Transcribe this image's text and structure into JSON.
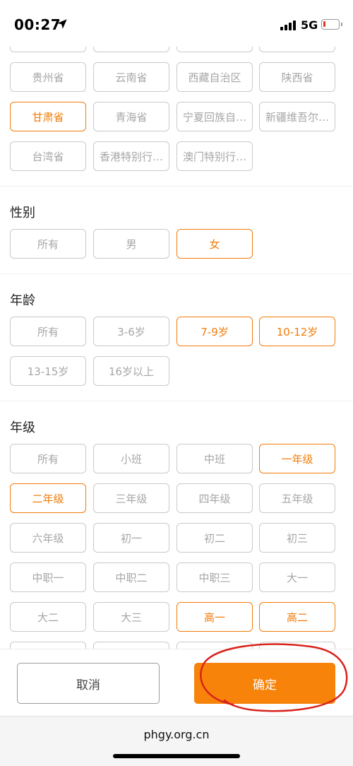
{
  "status": {
    "time": "00:27",
    "network": "5G",
    "battery_level": 0.1,
    "battery_color": "#e0382f"
  },
  "colors": {
    "accent": "#f27c0a",
    "confirm_bg": "#f8830b",
    "annotation": "#d8231b"
  },
  "province": {
    "options": [
      {
        "label": "贵州省",
        "selected": false
      },
      {
        "label": "云南省",
        "selected": false
      },
      {
        "label": "西藏自治区",
        "selected": false
      },
      {
        "label": "陕西省",
        "selected": false
      },
      {
        "label": "甘肃省",
        "selected": true
      },
      {
        "label": "青海省",
        "selected": false
      },
      {
        "label": "宁夏回族自…",
        "selected": false
      },
      {
        "label": "新疆维吾尔…",
        "selected": false
      },
      {
        "label": "台湾省",
        "selected": false
      },
      {
        "label": "香港特别行…",
        "selected": false
      },
      {
        "label": "澳门特别行…",
        "selected": false
      }
    ]
  },
  "gender": {
    "title": "性别",
    "options": [
      {
        "label": "所有",
        "selected": false
      },
      {
        "label": "男",
        "selected": false
      },
      {
        "label": "女",
        "selected": true
      }
    ]
  },
  "age": {
    "title": "年龄",
    "options": [
      {
        "label": "所有",
        "selected": false
      },
      {
        "label": "3-6岁",
        "selected": false
      },
      {
        "label": "7-9岁",
        "selected": true
      },
      {
        "label": "10-12岁",
        "selected": true
      },
      {
        "label": "13-15岁",
        "selected": false
      },
      {
        "label": "16岁以上",
        "selected": false
      }
    ]
  },
  "grade": {
    "title": "年级",
    "options": [
      {
        "label": "所有",
        "selected": false
      },
      {
        "label": "小班",
        "selected": false
      },
      {
        "label": "中班",
        "selected": false
      },
      {
        "label": "一年级",
        "selected": true
      },
      {
        "label": "二年级",
        "selected": true
      },
      {
        "label": "三年级",
        "selected": false
      },
      {
        "label": "四年级",
        "selected": false
      },
      {
        "label": "五年级",
        "selected": false
      },
      {
        "label": "六年级",
        "selected": false
      },
      {
        "label": "初一",
        "selected": false
      },
      {
        "label": "初二",
        "selected": false
      },
      {
        "label": "初三",
        "selected": false
      },
      {
        "label": "中职一",
        "selected": false
      },
      {
        "label": "中职二",
        "selected": false
      },
      {
        "label": "中职三",
        "selected": false
      },
      {
        "label": "大一",
        "selected": false
      },
      {
        "label": "大二",
        "selected": false
      },
      {
        "label": "大三",
        "selected": false
      },
      {
        "label": "高一",
        "selected": true
      },
      {
        "label": "高二",
        "selected": true
      }
    ]
  },
  "actions": {
    "cancel_label": "取消",
    "confirm_label": "确定"
  },
  "browser": {
    "url": "phgy.org.cn"
  }
}
